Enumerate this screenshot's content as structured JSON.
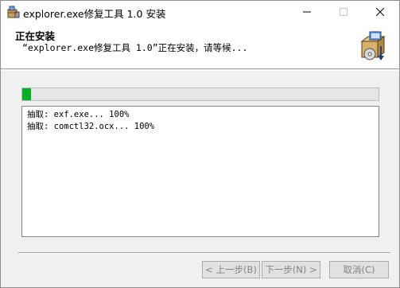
{
  "window": {
    "title": "explorer.exe修复工具 1.0 安装"
  },
  "header": {
    "title": "正在安装",
    "subtitle": "“explorer.exe修复工具 1.0”正在安装，请等候..."
  },
  "icons": {
    "app": "installer-box-icon",
    "header": "installer-package-icon",
    "minimize": "minimize-icon",
    "maximize": "maximize-icon",
    "close": "close-icon"
  },
  "progress": {
    "fraction": 0.025,
    "color": "#06b025"
  },
  "log": {
    "lines": [
      "抽取: exf.exe... 100%",
      "抽取: comctl32.ocx... 100%"
    ]
  },
  "buttons": {
    "back": "< 上一步(B)",
    "next": "下一步(N) >",
    "cancel": "取消(C)"
  }
}
